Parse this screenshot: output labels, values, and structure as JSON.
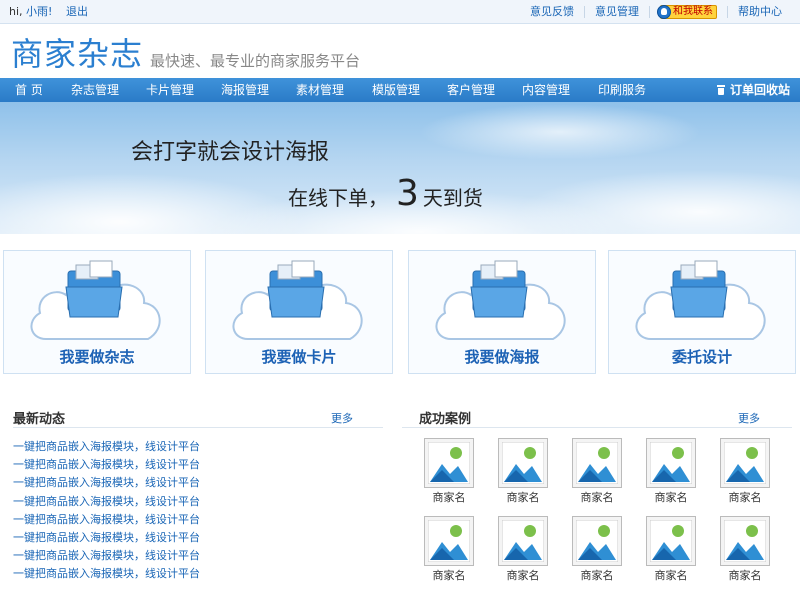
{
  "topbar": {
    "greeting": "hi,",
    "username": "小雨!",
    "logout": "退出",
    "links": [
      "意见反馈",
      "意见管理"
    ],
    "contact": "和我联系",
    "help": "帮助中心"
  },
  "header": {
    "logo": "商家杂志",
    "slogan": "最快速、最专业的商家服务平台"
  },
  "nav": {
    "items": [
      "首 页",
      "杂志管理",
      "卡片管理",
      "海报管理",
      "素材管理",
      "模版管理",
      "客户管理",
      "内容管理",
      "印刷服务"
    ],
    "recycle": "订单回收站"
  },
  "banner": {
    "line1": "会打字就会设计海报",
    "line2_prefix": "在线下单，",
    "line2_number": "3",
    "line2_suffix": "天到货"
  },
  "cards": [
    "我要做杂志",
    "我要做卡片",
    "我要做海报",
    "委托设计"
  ],
  "news": {
    "title": "最新动态",
    "more": "更多",
    "items": [
      "一键把商品嵌入海报模块，线设计平台",
      "一键把商品嵌入海报模块，线设计平台",
      "一键把商品嵌入海报模块，线设计平台",
      "一键把商品嵌入海报模块，线设计平台",
      "一键把商品嵌入海报模块，线设计平台",
      "一键把商品嵌入海报模块，线设计平台",
      "一键把商品嵌入海报模块，线设计平台",
      "一键把商品嵌入海报模块，线设计平台"
    ]
  },
  "cases": {
    "title": "成功案例",
    "more": "更多",
    "items": [
      "商家名",
      "商家名",
      "商家名",
      "商家名",
      "商家名",
      "商家名",
      "商家名",
      "商家名",
      "商家名",
      "商家名"
    ]
  },
  "colors": {
    "brand": "#2b7fd0",
    "nav": "#2a7bc7",
    "link": "#1a66b6",
    "card_title": "#1d62b5"
  }
}
